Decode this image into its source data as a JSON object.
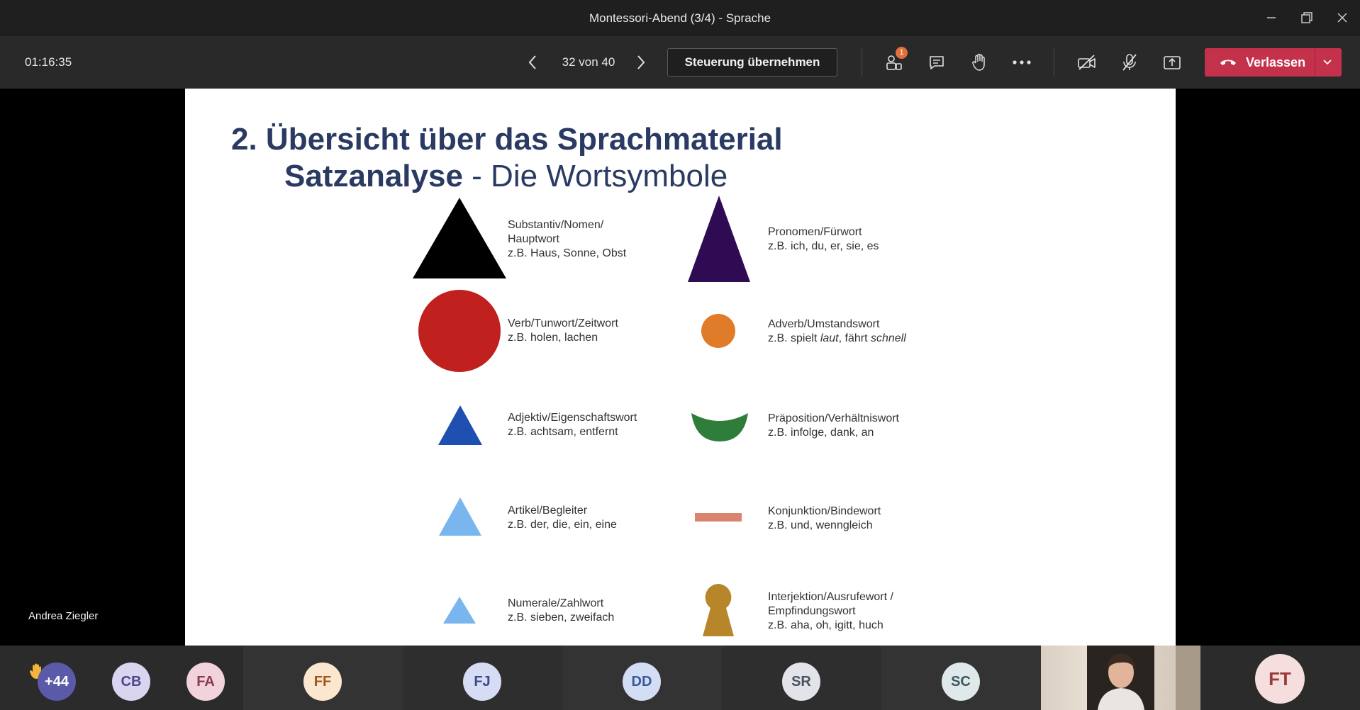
{
  "window": {
    "title": "Montessori-Abend (3/4) - Sprache"
  },
  "toolbar": {
    "timer": "01:16:35",
    "pager": "32 von 40",
    "takeover_label": "Steuerung übernehmen",
    "participants_badge": "1",
    "leave_label": "Verlassen"
  },
  "slide": {
    "title": "2. Übersicht über das Sprachmaterial",
    "subtitle_bold": "Satzanalyse",
    "subtitle_rest": " - Die Wortsymbole",
    "items": [
      {
        "lines": [
          "Substantiv/Nomen/",
          "Hauptwort",
          "z.B. Haus, Sonne, Obst"
        ],
        "color": "#000000",
        "shape": "large-triangle-icon"
      },
      {
        "lines": [
          "Pronomen/Fürwort",
          "z.B. ich, du, er, sie, es"
        ],
        "color": "#2e0b52",
        "shape": "tall-triangle-icon"
      },
      {
        "lines": [
          "Verb/Tunwort/Zeitwort",
          "z.B. holen, lachen"
        ],
        "color": "#c0201e",
        "shape": "large-circle-icon"
      },
      {
        "lines": [
          "Adverb/Umstandswort"
        ],
        "color": "#e07b2a",
        "shape": "small-circle-icon"
      },
      {
        "lines": [
          "Adjektiv/Eigenschaftswort",
          "z.B. achtsam, entfernt"
        ],
        "color": "#1f4fb0",
        "shape": "medium-triangle-icon"
      },
      {
        "lines": [
          "Präposition/Verhältniswort",
          "z.B. infolge, dank, an"
        ],
        "color": "#2f7d3a",
        "shape": "crescent-icon"
      },
      {
        "lines": [
          "Artikel/Begleiter",
          "z.B. der, die, ein, eine"
        ],
        "color": "#7ab6ee",
        "shape": "light-triangle-icon"
      },
      {
        "lines": [
          "Konjunktion/Bindewort",
          "z.B. und, wenngleich"
        ],
        "color": "#d8846e",
        "shape": "bar-icon"
      },
      {
        "lines": [
          "Numerale/Zahlwort",
          "z.B. sieben, zweifach"
        ],
        "color": "#7ab6ee",
        "shape": "small-triangle-icon"
      },
      {
        "lines": [
          "Interjektion/Ausrufewort /",
          "Empfindungswort",
          "z.B. aha, oh, igitt, huch"
        ],
        "color": "#b8862a",
        "shape": "keyhole-icon"
      }
    ],
    "adverb_example": {
      "prefix": "z.B. spielt ",
      "word1": "laut",
      "middle": ", fährt ",
      "word2": "schnell"
    }
  },
  "presenter_name": "Andrea Ziegler",
  "participants": [
    {
      "initials": "+44",
      "bg": "#5a5aa8",
      "fg": "#ffffff"
    },
    {
      "initials": "CB",
      "bg": "#d9d4ef",
      "fg": "#4a4a8a"
    },
    {
      "initials": "FA",
      "bg": "#f2d3dc",
      "fg": "#8a3a55"
    },
    {
      "initials": "FF",
      "bg": "#fbe6cf",
      "fg": "#a0561a"
    },
    {
      "initials": "FJ",
      "bg": "#d6dcf3",
      "fg": "#3b4a8a"
    },
    {
      "initials": "DD",
      "bg": "#d3def4",
      "fg": "#3a5a9a"
    },
    {
      "initials": "SR",
      "bg": "#e2e4ea",
      "fg": "#4a5260"
    },
    {
      "initials": "SC",
      "bg": "#dfe9ea",
      "fg": "#3a5a60"
    },
    {
      "initials": "FT",
      "bg": "#f6dede",
      "fg": "#9a3a3a"
    }
  ],
  "colors": {
    "leave": "#c4314b",
    "title_text": "#2a3a62"
  }
}
